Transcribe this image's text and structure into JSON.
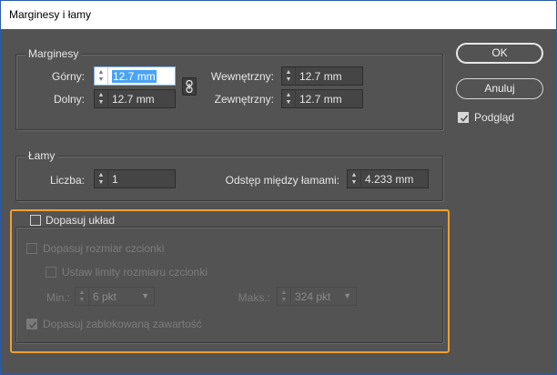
{
  "window": {
    "title": "Marginesy i łamy"
  },
  "margins": {
    "legend": "Marginesy",
    "top": {
      "label": "Górny:",
      "value": "12.7 mm"
    },
    "bottom": {
      "label": "Dolny:",
      "value": "12.7 mm"
    },
    "inside": {
      "label": "Wewnętrzny:",
      "value": "12.7 mm"
    },
    "outside": {
      "label": "Zewnętrzny:",
      "value": "12.7 mm"
    }
  },
  "columns": {
    "legend": "Łamy",
    "count": {
      "label": "Liczba:",
      "value": "1"
    },
    "gutter": {
      "label": "Odstęp między łamami:",
      "value": "4.233 mm"
    }
  },
  "adjust": {
    "enable_label": "Dopasuj układ",
    "enable_checked": false,
    "font_size_label": "Dopasuj rozmiar czcionki",
    "font_limits_label": "Ustaw limity rozmiaru czcionki",
    "min": {
      "label": "Min.:",
      "value": "6 pkt"
    },
    "max": {
      "label": "Maks.:",
      "value": "324 pkt"
    },
    "locked_label": "Dopasuj zablokowaną zawartość",
    "locked_checked": true
  },
  "buttons": {
    "ok": "OK",
    "cancel": "Anuluj"
  },
  "preview": {
    "label": "Podgląd",
    "checked": true
  },
  "colors": {
    "accent": "#f0a030",
    "selection": "#4aa3f5",
    "background": "#535353"
  }
}
